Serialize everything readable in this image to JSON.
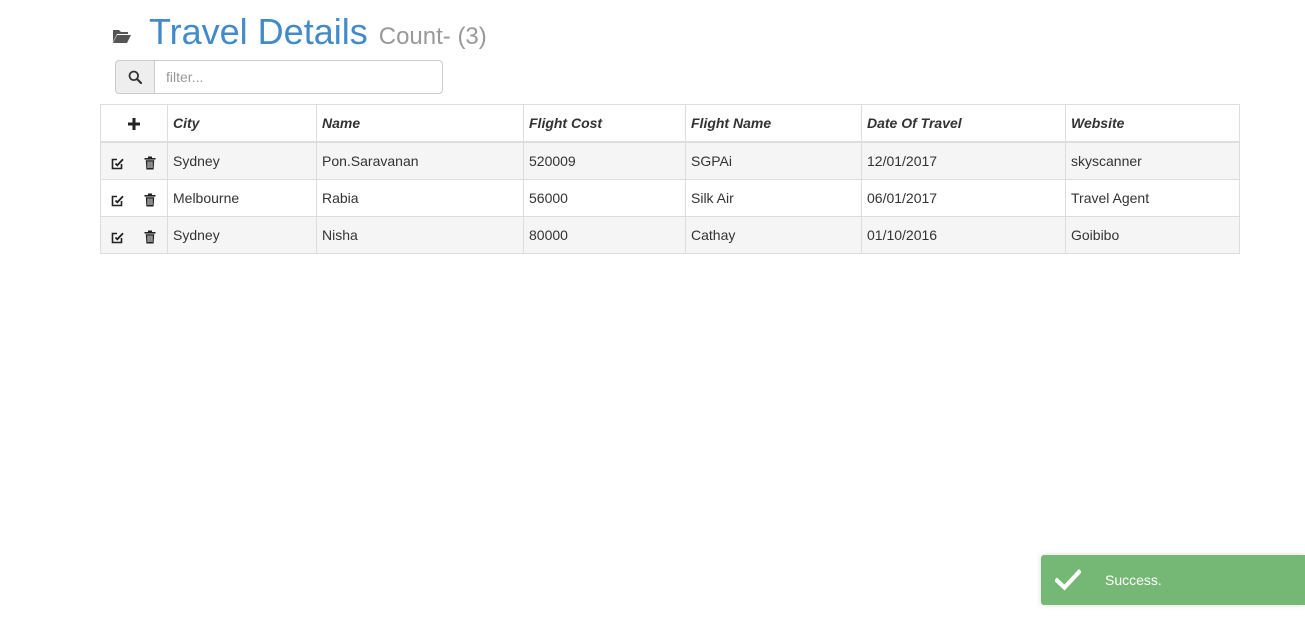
{
  "header": {
    "title": "Travel Details",
    "count_label": "Count- (3)",
    "icon": "folder-open-icon"
  },
  "filter": {
    "icon": "search-icon",
    "placeholder": "filter...",
    "value": ""
  },
  "table": {
    "add_icon": "plus-icon",
    "columns": [
      "City",
      "Name",
      "Flight Cost",
      "Flight Name",
      "Date Of Travel",
      "Website"
    ],
    "rows": [
      {
        "city": "Sydney",
        "name": "Pon.Saravanan",
        "flight_cost": "520009",
        "flight_name": "SGPAi",
        "date_of_travel": "12/01/2017",
        "website": "skyscanner"
      },
      {
        "city": "Melbourne",
        "name": "Rabia",
        "flight_cost": "56000",
        "flight_name": "Silk Air",
        "date_of_travel": "06/01/2017",
        "website": "Travel Agent"
      },
      {
        "city": "Sydney",
        "name": "Nisha",
        "flight_cost": "80000",
        "flight_name": "Cathay",
        "date_of_travel": "01/10/2016",
        "website": "Goibibo"
      }
    ],
    "row_actions": [
      "edit-icon",
      "trash-icon"
    ]
  },
  "toast": {
    "icon": "checkmark-icon",
    "message": "Success.",
    "color": "#75b775"
  },
  "colors": {
    "title": "#428bca",
    "count": "#999999"
  }
}
